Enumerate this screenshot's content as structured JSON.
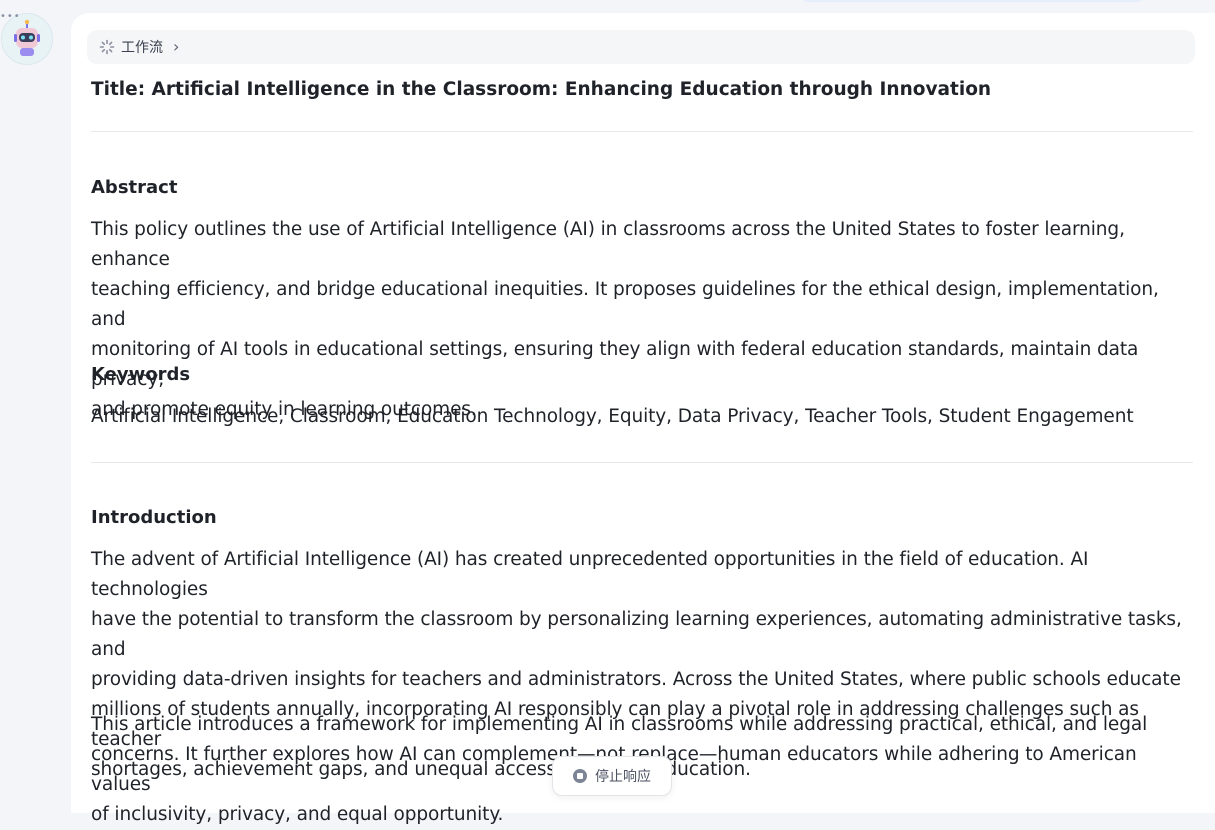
{
  "workflow": {
    "label": "工作流"
  },
  "document": {
    "title": "Title: Artificial Intelligence in the Classroom: Enhancing Education through Innovation",
    "abstract_heading": "Abstract",
    "abstract_lines": [
      "This policy outlines the use of Artificial Intelligence (AI) in classrooms across the United States to foster learning, enhance",
      "teaching efficiency, and bridge educational inequities. It proposes guidelines for the ethical design, implementation, and",
      "monitoring of AI tools in educational settings, ensuring they align with federal education standards, maintain data privacy,",
      "and promote equity in learning outcomes."
    ],
    "keywords_heading": "Keywords",
    "keywords": "Artificial Intelligence, Classroom, Education Technology, Equity, Data Privacy, Teacher Tools, Student Engagement",
    "introduction_heading": "Introduction",
    "intro_p1_lines": [
      "The advent of Artificial Intelligence (AI) has created unprecedented opportunities in the field of education. AI technologies",
      "have the potential to transform the classroom by personalizing learning experiences, automating administrative tasks, and",
      "providing data-driven insights for teachers and administrators. Across the United States, where public schools educate",
      "millions of students annually, incorporating AI responsibly can play a pivotal role in addressing challenges such as teacher",
      "shortages, achievement gaps, and unequal access to quality education."
    ],
    "intro_p2_lines": [
      "This article introduces a framework for implementing AI in classrooms while addressing practical, ethical, and legal",
      "concerns. It further explores how AI can complement—not replace—human educators while adhering to American values",
      "of inclusivity, privacy, and equal opportunity."
    ]
  },
  "stop_button": {
    "label": "停止响应"
  },
  "colors": {
    "page_bg": "#f3f5f9",
    "card_bg": "#ffffff",
    "text": "#1f2329"
  },
  "icons": {
    "avatar": "robot-avatar-icon",
    "workflow": "loading-spinner-icon",
    "chevron": "chevron-right-icon",
    "stop": "stop-icon"
  }
}
